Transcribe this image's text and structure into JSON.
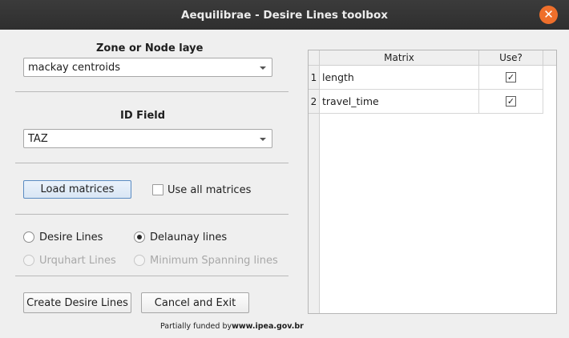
{
  "window": {
    "title": "Aequilibrae - Desire Lines toolbox",
    "close_icon": "close-icon",
    "close_glyph": "✕"
  },
  "zone_layer": {
    "label": "Zone or Node laye",
    "selected": "mackay centroids"
  },
  "id_field": {
    "label": "ID Field",
    "selected": "TAZ"
  },
  "matrices": {
    "load_button": "Load matrices",
    "use_all_label": "Use all matrices",
    "use_all_checked": false
  },
  "line_type": {
    "options": [
      {
        "label": "Desire Lines",
        "selected": false,
        "enabled": true
      },
      {
        "label": "Delaunay lines",
        "selected": true,
        "enabled": true
      },
      {
        "label": "Urquhart Lines",
        "selected": false,
        "enabled": false
      },
      {
        "label": "Minimum Spanning lines",
        "selected": false,
        "enabled": false
      }
    ]
  },
  "actions": {
    "create_button": "Create Desire Lines",
    "cancel_button": "Cancel and Exit"
  },
  "footer": {
    "prefix": "Partially funded by",
    "link": "www.ipea.gov.br"
  },
  "matrix_table": {
    "headers": {
      "matrix": "Matrix",
      "use": "Use?"
    },
    "rows": [
      {
        "num": "1",
        "name": "length",
        "use": true,
        "check_glyph": "✓"
      },
      {
        "num": "2",
        "name": "travel_time",
        "use": true,
        "check_glyph": "✓"
      }
    ]
  },
  "colors": {
    "titlebar": "#2f2f2f",
    "close_button": "#ef6f2b",
    "window_bg": "#efefef"
  }
}
